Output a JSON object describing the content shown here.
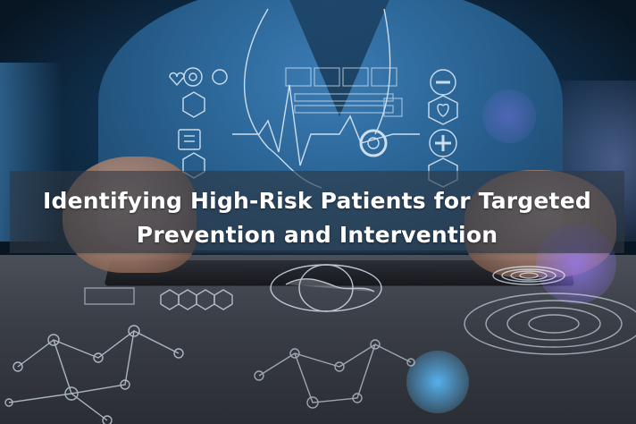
{
  "banner": {
    "title_line1": "Identifying High-Risk Patients for Targeted",
    "title_line2": "Prevention and Intervention"
  },
  "photo": {
    "icons": [
      "heart-icon",
      "pill-icon",
      "clipboard-icon",
      "shield-plus-icon",
      "globe-icon",
      "fingerprint-icon",
      "stethoscope-icon"
    ],
    "colors": {
      "scrubs": "#2b6596",
      "overlay_lines": "#e8f4ff",
      "banner": "#2d3742",
      "title_text": "#ffffff"
    }
  }
}
